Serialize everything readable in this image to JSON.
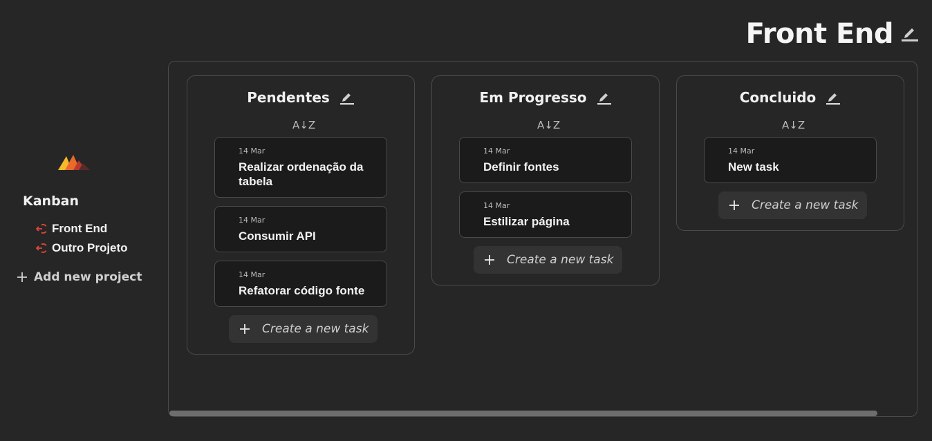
{
  "sidebar": {
    "logo_icon": "mountain-logo-icon",
    "app_title": "Kanban",
    "projects": [
      {
        "label": "Front End",
        "icon": "logout-icon"
      },
      {
        "label": "Outro Projeto",
        "icon": "logout-icon"
      }
    ],
    "add_project_label": "Add new project"
  },
  "header": {
    "title": "Front End",
    "edit_icon": "pencil-icon"
  },
  "board": {
    "columns": [
      {
        "title": "Pendentes",
        "sort_icon": "A↓Z",
        "tasks": [
          {
            "date": "14 Mar",
            "title": "Realizar ordenação da tabela"
          },
          {
            "date": "14 Mar",
            "title": "Consumir API"
          },
          {
            "date": "14 Mar",
            "title": "Refatorar código fonte"
          }
        ],
        "create_label": "Create a new task"
      },
      {
        "title": "Em Progresso",
        "sort_icon": "A↓Z",
        "tasks": [
          {
            "date": "14 Mar",
            "title": "Definir fontes"
          },
          {
            "date": "14 Mar",
            "title": "Estilizar página"
          }
        ],
        "create_label": "Create a new task"
      },
      {
        "title": "Concluido",
        "sort_icon": "A↓Z",
        "tasks": [
          {
            "date": "14 Mar",
            "title": "New task"
          }
        ],
        "create_label": "Create a new task"
      }
    ]
  },
  "colors": {
    "background": "#262626",
    "card": "#1b1b1b",
    "border": "#4a4a4a",
    "accent_red": "#e0463a",
    "logo_orange": "#f29a2e"
  }
}
